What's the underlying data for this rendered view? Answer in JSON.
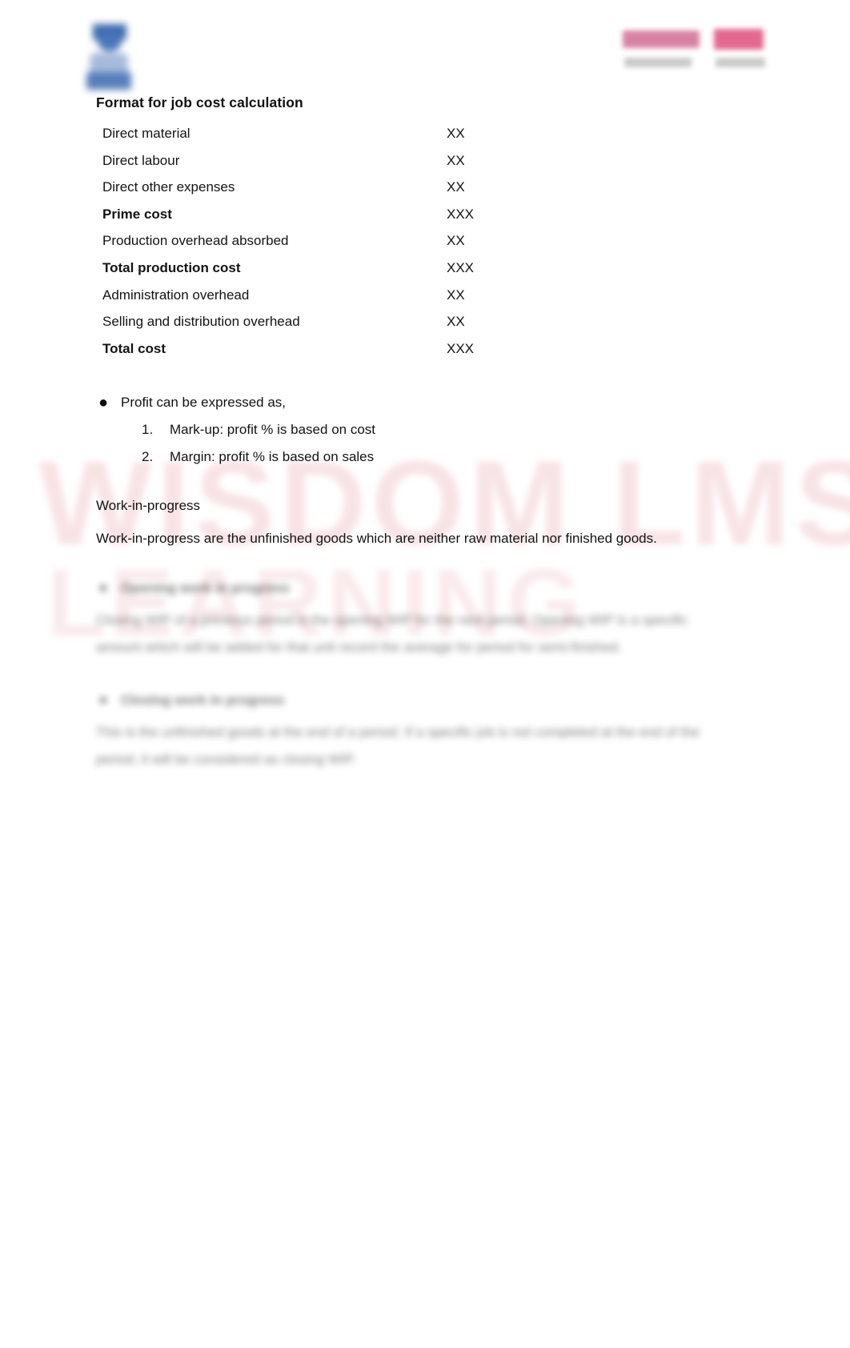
{
  "document": {
    "page_background": "#ffffff",
    "heading": "Format for job cost calculation"
  },
  "logos": {
    "left": {
      "name": "institution-logo",
      "primary_color": "#2e5fa8"
    },
    "right": {
      "name": "brand-logo",
      "primary_color": "#c0356a",
      "secondary_color": "#8d8d8d"
    }
  },
  "watermark": {
    "line1": "WISDOM LMS",
    "line2": "LEARNING",
    "color": "#e8a5ad"
  },
  "cost_table": {
    "rows": [
      {
        "label": "Direct material",
        "value": "XX",
        "bold": false
      },
      {
        "label": "Direct labour",
        "value": "XX",
        "bold": false
      },
      {
        "label": "Direct other expenses",
        "value": "XX",
        "bold": false
      },
      {
        "label": "Prime cost",
        "value": "XXX",
        "bold": true
      },
      {
        "label": "Production overhead absorbed",
        "value": "XX",
        "bold": false
      },
      {
        "label": "Total production cost",
        "value": "XXX",
        "bold": true
      },
      {
        "label": "Administration overhead",
        "value": "XX",
        "bold": false
      },
      {
        "label": "Selling and distribution overhead",
        "value": "XX",
        "bold": false
      },
      {
        "label": "Total cost",
        "value": "XXX",
        "bold": true
      }
    ]
  },
  "profit_section": {
    "bullet_marker": "●",
    "bullet_text": "Profit can be expressed as,",
    "items": [
      {
        "marker": "1.",
        "text": "Mark-up: profit % is based on cost"
      },
      {
        "marker": "2.",
        "text": "Margin: profit % is based on sales"
      }
    ]
  },
  "work_in_progress": {
    "title": "Work-in-progress",
    "body": "Work-in-progress are the unfinished goods which are neither raw material nor finished goods."
  },
  "locked_content": {
    "groups": [
      {
        "marker": "●",
        "heading": "Opening work in progress",
        "paragraph": "Closing WIP of a previous period is the opening WIP for the next period. Opening WIP is a specific amount which will be added for that unit record the average for period for semi-finished."
      },
      {
        "marker": "●",
        "heading": "Closing work in progress",
        "paragraph": "This is the unfinished goods at the end of a period. If a specific job is not completed at the end of the period, it will be considered as closing WIP."
      }
    ]
  }
}
